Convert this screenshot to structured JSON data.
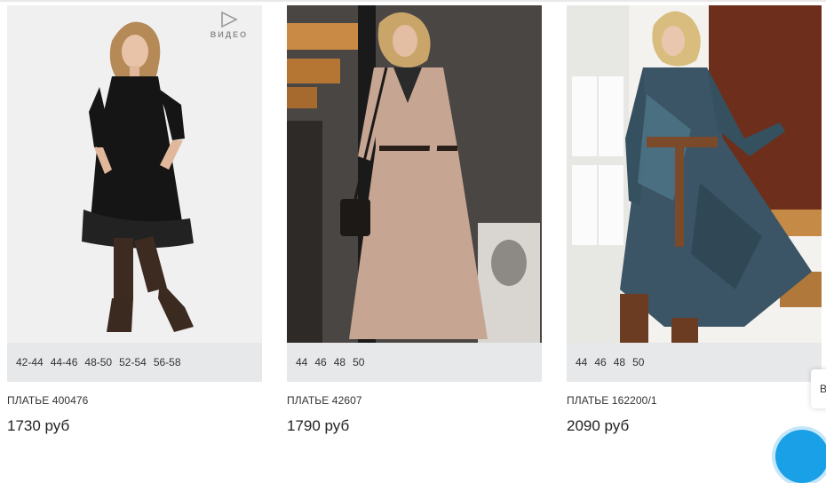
{
  "products": [
    {
      "video_label": "ВИДЕО",
      "sizes": [
        "42-44",
        "44-46",
        "48-50",
        "52-54",
        "56-58"
      ],
      "name": "ПЛАТЬЕ 400476",
      "price": "1730 руб"
    },
    {
      "sizes": [
        "44",
        "46",
        "48",
        "50"
      ],
      "name": "ПЛАТЬЕ 42607",
      "price": "1790 руб"
    },
    {
      "sizes": [
        "44",
        "46",
        "48",
        "50"
      ],
      "name": "ПЛАТЬЕ 162200/1",
      "price": "2090 руб"
    }
  ],
  "side_button": {
    "label": "В"
  },
  "icons": {
    "play": "play-icon",
    "chat": "chat-icon"
  },
  "colors": {
    "sizes_bg": "#e6e8ea",
    "chat": "#1aa0e6"
  }
}
